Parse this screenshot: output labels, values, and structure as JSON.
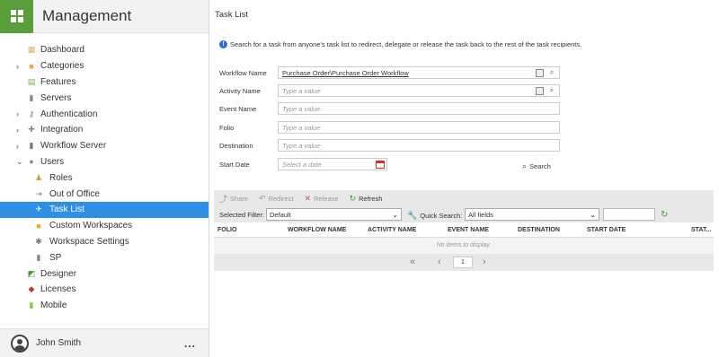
{
  "app": {
    "title": "Management"
  },
  "sidebar": {
    "items": [
      {
        "label": "Dashboard",
        "icon": "dashboard-icon",
        "expandable": false
      },
      {
        "label": "Categories",
        "icon": "folder-icon",
        "expandable": true
      },
      {
        "label": "Features",
        "icon": "features-icon",
        "expandable": false
      },
      {
        "label": "Servers",
        "icon": "server-icon",
        "expandable": false
      },
      {
        "label": "Authentication",
        "icon": "key-icon",
        "expandable": true
      },
      {
        "label": "Integration",
        "icon": "puzzle-icon",
        "expandable": true
      },
      {
        "label": "Workflow Server",
        "icon": "workflow-server-icon",
        "expandable": true
      },
      {
        "label": "Users",
        "icon": "users-icon",
        "expandable": true,
        "expanded": true
      },
      {
        "label": "Roles",
        "icon": "roles-icon",
        "sub": true
      },
      {
        "label": "Out of Office",
        "icon": "out-of-office-icon",
        "sub": true
      },
      {
        "label": "Task List",
        "icon": "task-list-icon",
        "sub": true,
        "active": true
      },
      {
        "label": "Custom Workspaces",
        "icon": "workspace-icon",
        "sub": true
      },
      {
        "label": "Workspace Settings",
        "icon": "settings-icon",
        "sub": true
      },
      {
        "label": "SP",
        "icon": "sp-icon",
        "sub": true
      },
      {
        "label": "Designer",
        "icon": "designer-icon",
        "expandable": false
      },
      {
        "label": "Licenses",
        "icon": "license-icon",
        "expandable": false
      },
      {
        "label": "Mobile",
        "icon": "mobile-icon",
        "expandable": false
      }
    ],
    "user": {
      "name": "John Smith",
      "more": "..."
    }
  },
  "main": {
    "title": "Task List",
    "info": "Search for a task from anyone's task list to redirect, delegate or release the task back to the rest of the task recipients.",
    "form": {
      "workflow_name": {
        "label": "Workflow Name",
        "value": "Purchase Order\\Purchase Order Workflow"
      },
      "activity_name": {
        "label": "Activity Name",
        "placeholder": "Type a value"
      },
      "event_name": {
        "label": "Event Name",
        "placeholder": "Type a value"
      },
      "folio": {
        "label": "Folio",
        "placeholder": "Type a value"
      },
      "destination": {
        "label": "Destination",
        "placeholder": "Type a value"
      },
      "start_date": {
        "label": "Start Date",
        "placeholder": "Select a date"
      },
      "search_label": "Search"
    },
    "toolbar": {
      "share": "Share",
      "redirect": "Redirect",
      "release": "Release",
      "refresh": "Refresh"
    },
    "filter": {
      "selected_filter_label": "Selected Filter:",
      "selected_filter_value": "Default",
      "quick_search_label": "Quick Search:",
      "quick_search_value": "All fields"
    },
    "grid": {
      "columns": [
        "FOLIO",
        "WORKFLOW NAME",
        "ACTIVITY NAME",
        "EVENT NAME",
        "DESTINATION",
        "START DATE",
        "STAT..."
      ],
      "empty": "No items to display.",
      "page": "1"
    }
  },
  "colors": {
    "accent": "#2d8fe6",
    "brand": "#5a9e3b"
  }
}
